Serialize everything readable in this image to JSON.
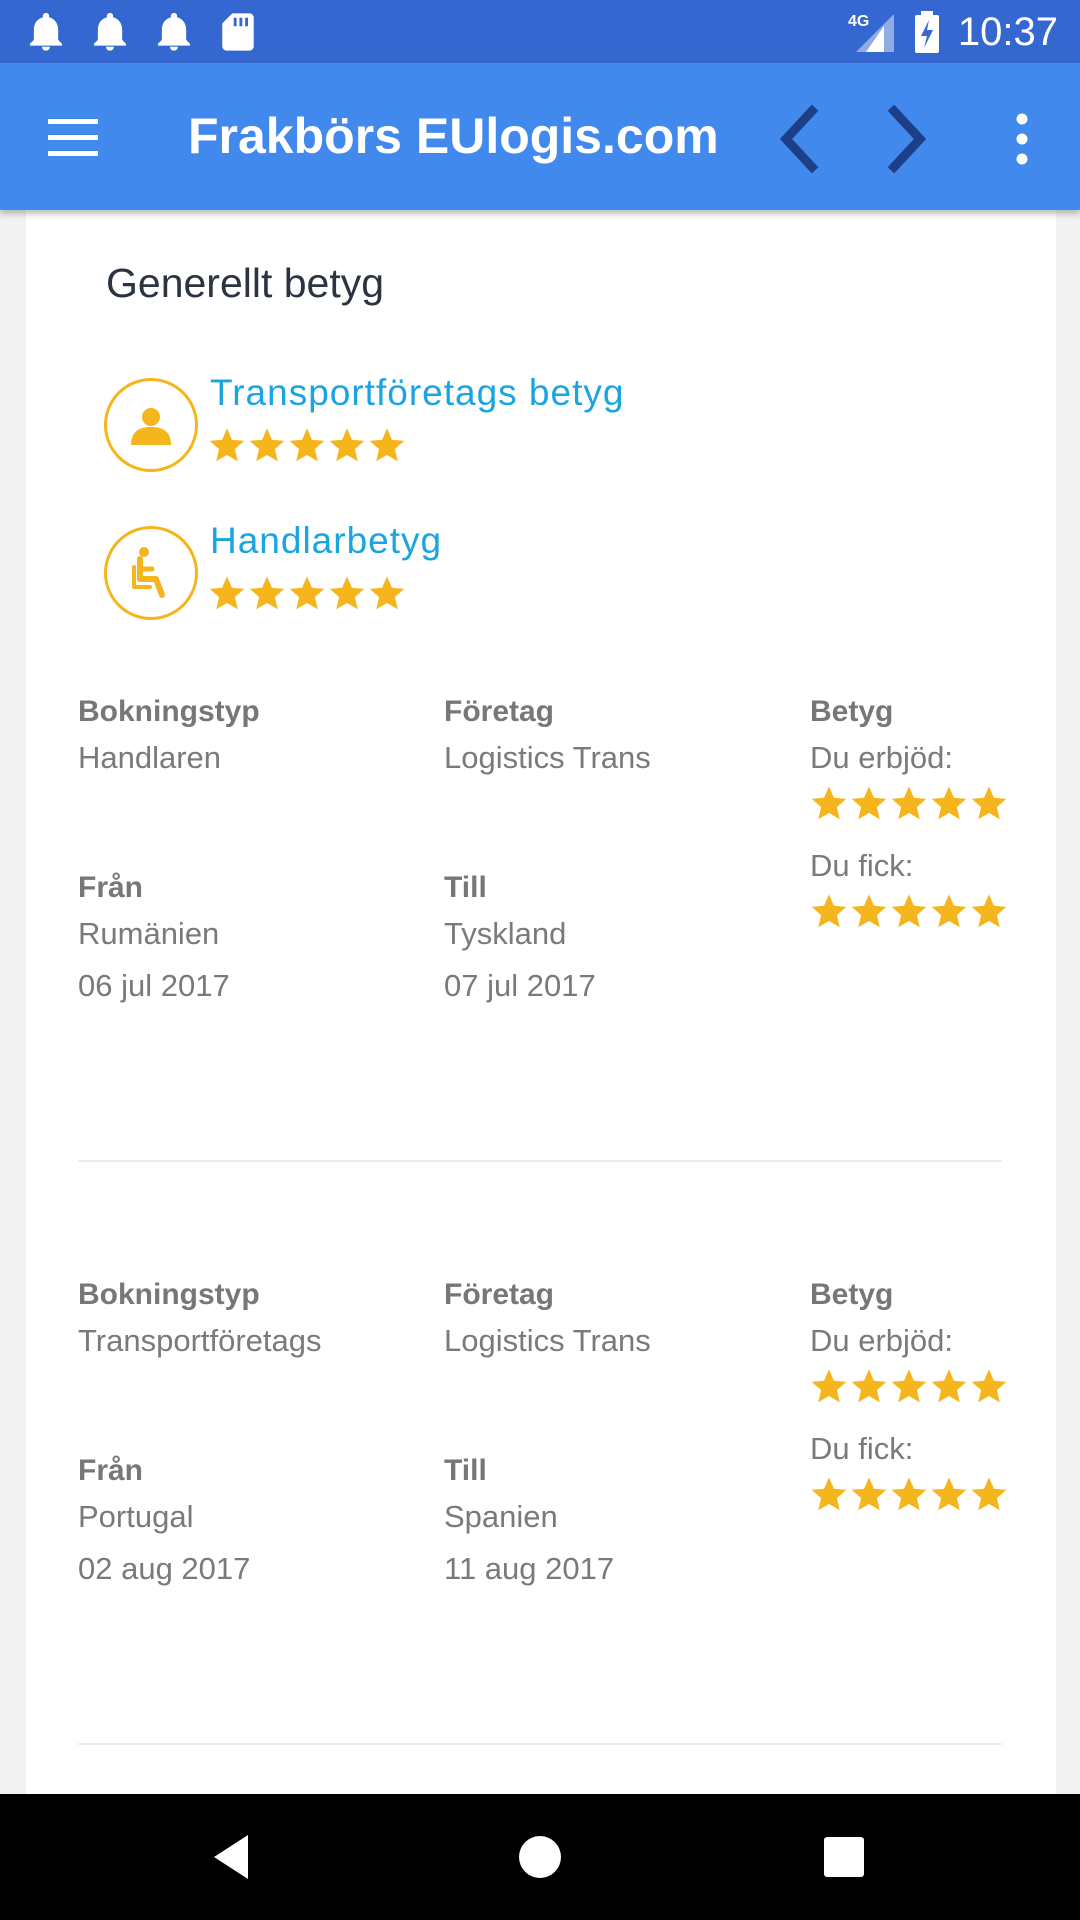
{
  "status_bar": {
    "time": "10:37",
    "network": "4G",
    "icons": [
      "notification-bell-icon",
      "notification-bell-icon",
      "notification-bell-icon",
      "sd-card-icon",
      "signal-icon",
      "battery-charging-icon"
    ]
  },
  "app_bar": {
    "title": "Frakbörs EUlogis.com",
    "icons": [
      "menu-icon",
      "chevron-left-icon",
      "chevron-right-icon",
      "more-vert-icon"
    ]
  },
  "colors": {
    "status_bar": "#3567d0",
    "app_bar": "#4289ee",
    "star": "#f5b51c",
    "link": "#1ba5e0"
  },
  "overall": {
    "title": "Generellt betyg",
    "ratings": [
      {
        "label": "Transportföretags betyg",
        "icon": "person-icon",
        "stars": 5
      },
      {
        "label": "Handlarbetyg",
        "icon": "seated-person-icon",
        "stars": 5
      }
    ]
  },
  "bookings": [
    {
      "type_label": "Bokningstyp",
      "type_value": "Handlaren",
      "company_label": "Företag",
      "company_value": "Logistics Trans",
      "rating_label": "Betyg",
      "offered_label": "Du erbjöd:",
      "offered_stars": 5,
      "received_label": "Du fick:",
      "received_stars": 5,
      "from_label": "Från",
      "from_place": "Rumänien",
      "from_date": "06 jul 2017",
      "to_label": "Till",
      "to_place": "Tyskland",
      "to_date": "07 jul 2017"
    },
    {
      "type_label": "Bokningstyp",
      "type_value": "Transportföretags",
      "company_label": "Företag",
      "company_value": "Logistics Trans",
      "rating_label": "Betyg",
      "offered_label": "Du erbjöd:",
      "offered_stars": 5,
      "received_label": "Du fick:",
      "received_stars": 5,
      "from_label": "Från",
      "from_place": "Portugal",
      "from_date": "02 aug 2017",
      "to_label": "Till",
      "to_place": "Spanien",
      "to_date": "11 aug 2017"
    }
  ],
  "nav_bar": {
    "icons": [
      "back-triangle-icon",
      "home-circle-icon",
      "recents-square-icon"
    ]
  }
}
